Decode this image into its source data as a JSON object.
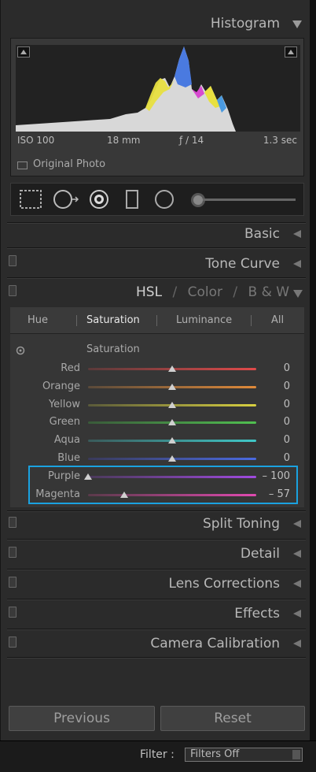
{
  "histogram": {
    "title": "Histogram",
    "iso": "ISO 100",
    "focal_length": "18 mm",
    "aperture": "ƒ / 14",
    "shutter": "1.3 sec",
    "original_photo_label": "Original Photo"
  },
  "panels": {
    "basic": "Basic",
    "tone_curve": "Tone Curve",
    "hsl_header": {
      "hsl": "HSL",
      "color": "Color",
      "bw": "B & W",
      "sep": "/"
    },
    "split_toning": "Split Toning",
    "detail": "Detail",
    "lens_corrections": "Lens Corrections",
    "effects": "Effects",
    "camera_calibration": "Camera Calibration"
  },
  "hsl": {
    "tabs": [
      "Hue",
      "Saturation",
      "Luminance",
      "All"
    ],
    "active_tab": "Saturation",
    "section_title": "Saturation",
    "sliders": [
      {
        "label": "Red",
        "value": "0",
        "num": 0,
        "color_a": "#5a3a3a",
        "color_b": "#e04a4a"
      },
      {
        "label": "Orange",
        "value": "0",
        "num": 0,
        "color_a": "#5a4a3a",
        "color_b": "#e08a3a"
      },
      {
        "label": "Yellow",
        "value": "0",
        "num": 0,
        "color_a": "#5a5a3a",
        "color_b": "#d8d040"
      },
      {
        "label": "Green",
        "value": "0",
        "num": 0,
        "color_a": "#3a5a3a",
        "color_b": "#50c050"
      },
      {
        "label": "Aqua",
        "value": "0",
        "num": 0,
        "color_a": "#3a5a5a",
        "color_b": "#40c8c8"
      },
      {
        "label": "Blue",
        "value": "0",
        "num": 0,
        "color_a": "#3a3a5a",
        "color_b": "#4a6ae0"
      },
      {
        "label": "Purple",
        "value": "– 100",
        "num": -100,
        "color_a": "#4a3a5a",
        "color_b": "#a04ae0"
      },
      {
        "label": "Magenta",
        "value": "– 57",
        "num": -57,
        "color_a": "#5a3a4a",
        "color_b": "#e04ab0"
      }
    ]
  },
  "buttons": {
    "previous": "Previous",
    "reset": "Reset"
  },
  "footer": {
    "filter_label": "Filter :",
    "filter_value": "Filters Off"
  },
  "colors": {
    "highlight": "#1aa2e0"
  }
}
